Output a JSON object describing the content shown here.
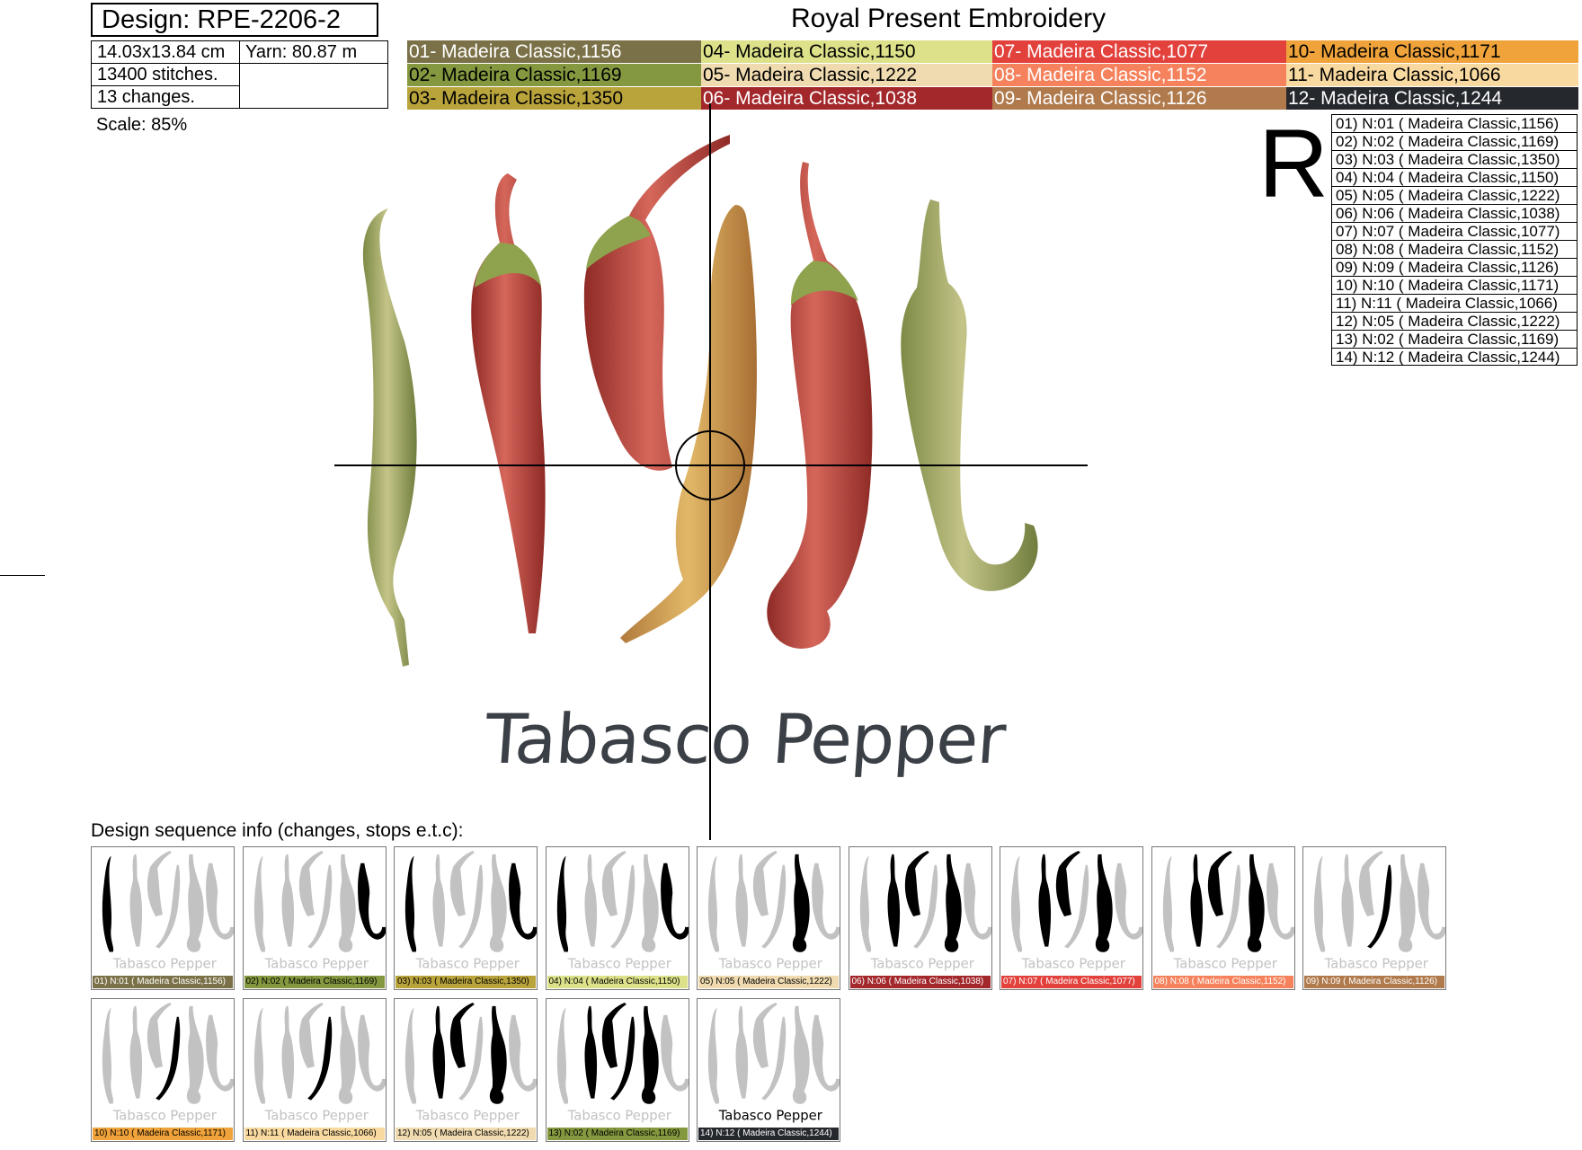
{
  "header": {
    "design_label": "Design: RPE-2206-2",
    "company": "Royal Present Embroidery"
  },
  "info": {
    "size": "14.03x13.84 cm",
    "yarn": "Yarn: 80.87 m",
    "stitches": "13400 stitches.",
    "changes": "13 changes.",
    "scale": "Scale: 85%"
  },
  "colors": [
    {
      "label": "01- Madeira Classic,1156",
      "bg": "#7b7148",
      "fg": "#ffffff"
    },
    {
      "label": "04- Madeira Classic,1150",
      "bg": "#dde28a",
      "fg": "#000000"
    },
    {
      "label": "07- Madeira Classic,1077",
      "bg": "#e2413c",
      "fg": "#ffffff"
    },
    {
      "label": "10- Madeira Classic,1171",
      "bg": "#f0a33a",
      "fg": "#000000"
    },
    {
      "label": "02- Madeira Classic,1169",
      "bg": "#84993f",
      "fg": "#000000"
    },
    {
      "label": "05- Madeira Classic,1222",
      "bg": "#f0dbb0",
      "fg": "#000000"
    },
    {
      "label": "08- Madeira Classic,1152",
      "bg": "#f5825c",
      "fg": "#ffffff"
    },
    {
      "label": "11- Madeira Classic,1066",
      "bg": "#f8d9a0",
      "fg": "#000000"
    },
    {
      "label": "03- Madeira Classic,1350",
      "bg": "#b9a43c",
      "fg": "#000000"
    },
    {
      "label": "06- Madeira Classic,1038",
      "bg": "#a3282c",
      "fg": "#ffffff"
    },
    {
      "label": "09- Madeira Classic,1126",
      "bg": "#b07a4c",
      "fg": "#ffffff"
    },
    {
      "label": "12- Madeira Classic,1244",
      "bg": "#25282d",
      "fg": "#ffffff"
    }
  ],
  "big_letter": "R",
  "sequence": [
    "01) N:01 ( Madeira Classic,1156)",
    "02) N:02 ( Madeira Classic,1169)",
    "03) N:03 ( Madeira Classic,1350)",
    "04) N:04 ( Madeira Classic,1150)",
    "05) N:05 ( Madeira Classic,1222)",
    "06) N:06 ( Madeira Classic,1038)",
    "07) N:07 ( Madeira Classic,1077)",
    "08) N:08 ( Madeira Classic,1152)",
    "09) N:09 ( Madeira Classic,1126)",
    "10) N:10 ( Madeira Classic,1171)",
    "11) N:11 ( Madeira Classic,1066)",
    "12) N:05 ( Madeira Classic,1222)",
    "13) N:02 ( Madeira Classic,1169)",
    "14) N:12 ( Madeira Classic,1244)"
  ],
  "design_text": "Tabasco Pepper",
  "seq_heading": "Design sequence info (changes, stops e.t.c):",
  "thumbs": [
    {
      "caption": "01) N:01 ( Madeira Classic,1156)",
      "bg": "#7b7148",
      "fg": "#ffffff",
      "highlight": [
        0
      ]
    },
    {
      "caption": "02) N:02 ( Madeira Classic,1169)",
      "bg": "#84993f",
      "fg": "#000000",
      "highlight": [
        5
      ]
    },
    {
      "caption": "03) N:03 ( Madeira Classic,1350)",
      "bg": "#b9a43c",
      "fg": "#000000",
      "highlight": [
        0,
        5
      ]
    },
    {
      "caption": "04) N:04 ( Madeira Classic,1150)",
      "bg": "#dde28a",
      "fg": "#000000",
      "highlight": [
        0,
        5
      ]
    },
    {
      "caption": "05) N:05 ( Madeira Classic,1222)",
      "bg": "#f0dbb0",
      "fg": "#000000",
      "highlight": [
        4
      ]
    },
    {
      "caption": "06) N:06 ( Madeira Classic,1038)",
      "bg": "#a3282c",
      "fg": "#ffffff",
      "highlight": [
        1,
        2,
        4
      ]
    },
    {
      "caption": "07) N:07 ( Madeira Classic,1077)",
      "bg": "#e2413c",
      "fg": "#ffffff",
      "highlight": [
        1,
        2,
        4
      ]
    },
    {
      "caption": "08) N:08 ( Madeira Classic,1152)",
      "bg": "#f5825c",
      "fg": "#ffffff",
      "highlight": [
        1,
        2,
        4
      ]
    },
    {
      "caption": "09) N:09 ( Madeira Classic,1126)",
      "bg": "#b07a4c",
      "fg": "#ffffff",
      "highlight": [
        3
      ]
    },
    {
      "caption": "10) N:10 ( Madeira Classic,1171)",
      "bg": "#f0a33a",
      "fg": "#000000",
      "highlight": [
        3
      ]
    },
    {
      "caption": "11) N:11 ( Madeira Classic,1066)",
      "bg": "#f8d9a0",
      "fg": "#000000",
      "highlight": [
        3
      ]
    },
    {
      "caption": "12) N:05 ( Madeira Classic,1222)",
      "bg": "#f0dbb0",
      "fg": "#000000",
      "highlight": [
        1,
        2,
        4
      ]
    },
    {
      "caption": "13) N:02 ( Madeira Classic,1169)",
      "bg": "#84993f",
      "fg": "#000000",
      "highlight": [
        1,
        2,
        3,
        4
      ]
    },
    {
      "caption": "14) N:12 ( Madeira Classic,1244)",
      "bg": "#25282d",
      "fg": "#ffffff",
      "highlight": [],
      "text_dark": true
    }
  ],
  "palette": {
    "pepper_green": "#a9ad6a",
    "pepper_green_dark": "#7d8a45",
    "pepper_red": "#c2443a",
    "pepper_red_dark": "#8e2a26",
    "pepper_yellow": "#d5a24e",
    "stem": "#8fa34e",
    "text_thread": "#3b3f46",
    "thumb_gray": "#c2c2c2"
  }
}
